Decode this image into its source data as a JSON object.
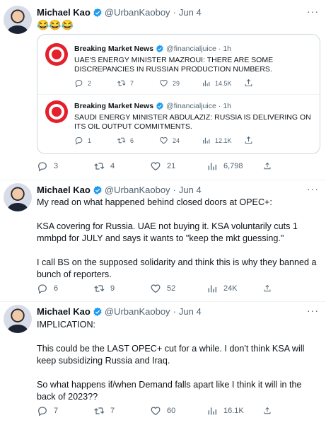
{
  "tweets": [
    {
      "name": "Michael Kao",
      "handle": "@UrbanKaoboy",
      "sep": "·",
      "date": "Jun 4",
      "text": [
        "😂😂😂"
      ],
      "quotes": [
        {
          "name": "Breaking Market News",
          "handle": "@financialjuice",
          "sep": "·",
          "date": "1h",
          "text": "UAE'S ENERGY MINISTER MAZROUI: THERE ARE SOME DISCREPANCIES IN RUSSIAN PRODUCTION NUMBERS.",
          "replies": "2",
          "retweets": "7",
          "likes": "29",
          "views": "14.5K"
        },
        {
          "name": "Breaking Market News",
          "handle": "@financialjuice",
          "sep": "·",
          "date": "1h",
          "text": "SAUDI ENERGY MINISTER ABDULAZIZ: RUSSIA IS DELIVERING ON ITS OIL OUTPUT COMMITMENTS.",
          "replies": "1",
          "retweets": "6",
          "likes": "24",
          "views": "12.1K"
        }
      ],
      "replies": "3",
      "retweets": "4",
      "likes": "21",
      "views": "6,798"
    },
    {
      "name": "Michael Kao",
      "handle": "@UrbanKaoboy",
      "sep": "·",
      "date": "Jun 4",
      "text": [
        "My read on what happened behind closed doors at OPEC+:",
        "KSA covering for Russia. UAE not buying it. KSA voluntarily cuts 1 mmbpd for JULY and says it wants to \"keep the mkt guessing.\"",
        "I call BS on the supposed solidarity and think this is why they banned a bunch of reporters."
      ],
      "replies": "6",
      "retweets": "9",
      "likes": "52",
      "views": "24K"
    },
    {
      "name": "Michael Kao",
      "handle": "@UrbanKaoboy",
      "sep": "·",
      "date": "Jun 4",
      "text": [
        "IMPLICATION:",
        "This could be the LAST OPEC+ cut for a while. I don't think KSA will keep subsidizing Russia and Iraq.",
        "So what happens if/when Demand falls apart like I think it will in the back of 2023??"
      ],
      "replies": "7",
      "retweets": "7",
      "likes": "60",
      "views": "16.1K"
    }
  ],
  "more_label": "···",
  "colors": {
    "verified": "#1d9bf0",
    "muted": "#536471",
    "text": "#0f1419",
    "border": "#cfd9de"
  }
}
